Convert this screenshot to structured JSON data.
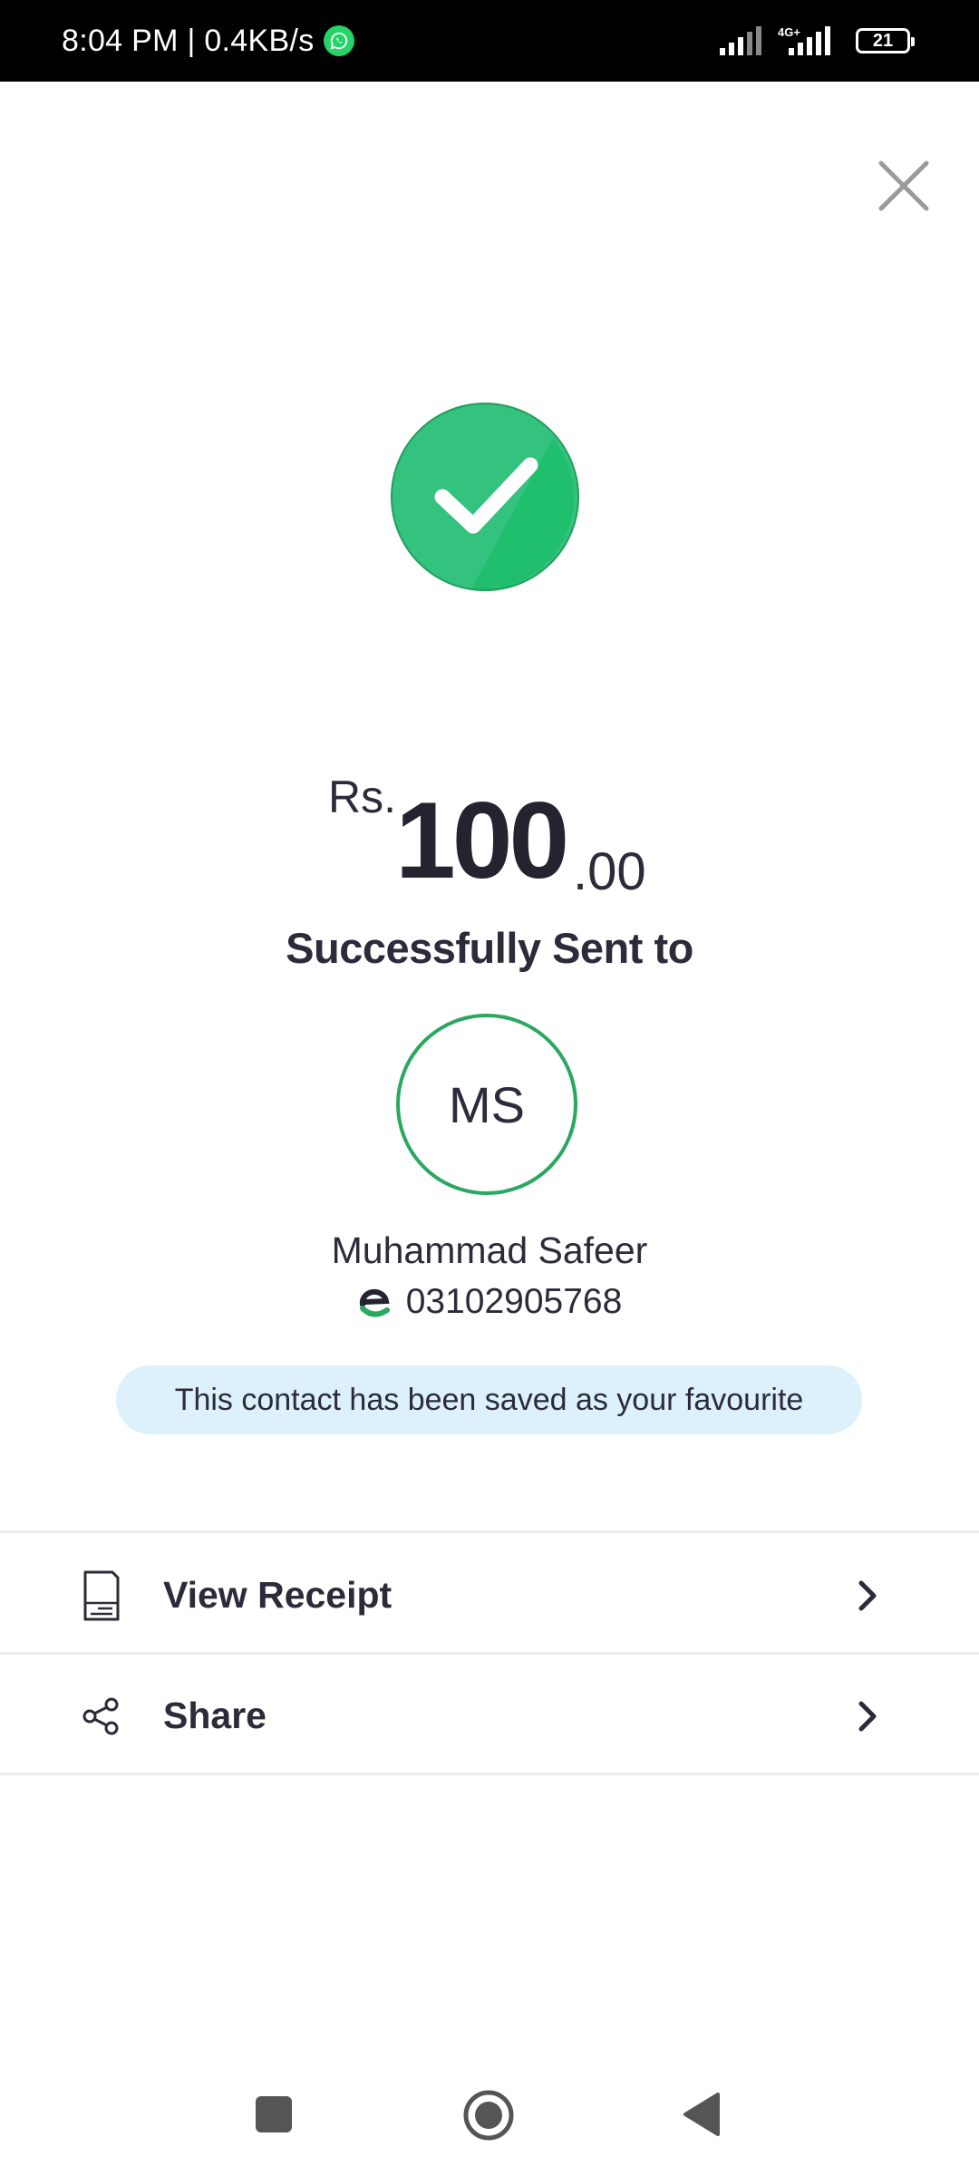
{
  "status_bar": {
    "time_speed": "8:04 PM | 0.4KB/s",
    "network": "4G+",
    "battery": "21",
    "icons": [
      "whatsapp-icon",
      "signal-icon",
      "signal-4g-icon",
      "battery-icon"
    ]
  },
  "header": {
    "close_icon": "close-icon"
  },
  "success": {
    "icon": "check-circle-icon",
    "color": "#1fbf6e"
  },
  "amount": {
    "currency": "Rs.",
    "whole": "100",
    "fraction": ".00"
  },
  "message": "Successfully Sent to",
  "recipient": {
    "initials": "MS",
    "name": "Muhammad Safeer",
    "number": "03102905768",
    "wallet_icon": "easypaisa-logo-icon"
  },
  "favourite_notice": "This contact has been saved as your favourite",
  "actions": [
    {
      "label": "View Receipt",
      "icon": "receipt-icon"
    },
    {
      "label": "Share",
      "icon": "share-icon"
    }
  ],
  "nav": {
    "icons": [
      "recents-square-icon",
      "home-circle-icon",
      "back-triangle-icon"
    ]
  },
  "colors": {
    "accent_green": "#2aa760",
    "banner_bg": "#dcf1fb",
    "text": "#2b2b3a"
  }
}
